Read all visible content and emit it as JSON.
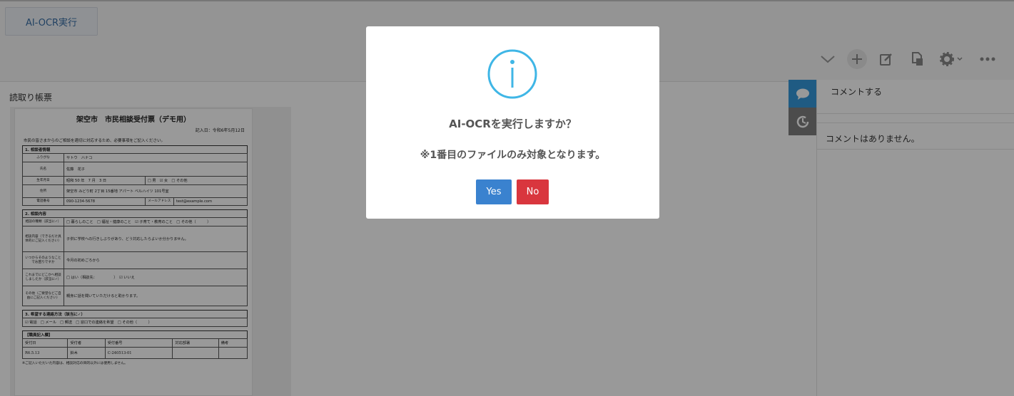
{
  "header": {
    "action_button_label": "AI-OCR実行",
    "toolbar_icons": [
      "chevron-down-icon",
      "plus-icon",
      "edit-icon",
      "copy-document-icon",
      "gear-icon",
      "more-icon"
    ]
  },
  "document": {
    "label": "読取り帳票",
    "form": {
      "title": "架空市　市民相談受付票（デモ用）",
      "date": "記入日：令和6年5月12日",
      "intro": "市民の皆さまからのご相談を適切に対応するため、必要事項をご記入ください。",
      "section1_title": "1. 相談者情報",
      "furigana_label": "ふりがな",
      "furigana_value": "サトウ　ハナコ",
      "name_label": "氏名",
      "name_value": "佐藤　花子",
      "birth_label": "生年月日",
      "birth_value": "昭和 50 年　7 月　3 日",
      "gender_options": "□ 男　☑ 女　□ その他",
      "address_label": "住所",
      "address_value": "架空市 みどり町 2丁目 15番地 アパート ベルハイツ 101号室",
      "phone_label": "電話番号",
      "phone_value": "090-1234-5678",
      "email_label": "メールアドレス",
      "email_value": "test@example.com",
      "section2_title": "2. 相談内容",
      "category_label": "相談の種類（該当に✓）",
      "category_options": "□ 暮らしのこと　□ 福祉・健康のこと　☑ 子育て・教育のこと　□ その他（　　　）",
      "detail_label": "相談内容（できるだけ具体的にご記入ください）",
      "detail_value": "子供に学校への行きしぶりがあり、どう対応したらよいか分かりません。",
      "since_label": "いつからそのようなことでお困りですか",
      "since_value": "今月の初めごろから",
      "prior_label": "これまでにどこかへ相談しましたか（該当に✓）",
      "prior_options": "□ はい（相談先：　　　　　）　☑ いいえ",
      "other_label": "その他（ご要望などご自由にご記入ください）",
      "other_value": "親身に話を聞いていただけると助かります。",
      "section3_title": "3. 希望する連絡方法（該当に✓）",
      "contact_options": "☑ 電話　□ メール　□ 郵送　□ 窓口での連絡を希望　□ その他（　　　）",
      "staff_title": "【職員記入欄】",
      "staff_headers": [
        "受付日",
        "受付者",
        "受付番号",
        "対応部署",
        "備考"
      ],
      "staff_values": [
        "R6.5.13",
        "鈴木",
        "C-240513-01",
        "",
        ""
      ],
      "footnote": "※ご記入いただいた内容は、相談対応の目的以外には使用しません。"
    }
  },
  "side_tabs": [
    {
      "icon": "comment-icon"
    },
    {
      "icon": "history-icon"
    }
  ],
  "comments": {
    "input_placeholder": "コメントする",
    "empty_text": "コメントはありません。"
  },
  "dialog": {
    "icon": "info-icon",
    "message": "AI-OCRを実行しますか？",
    "note": "※1番目のファイルのみ対象となります。",
    "yes_label": "Yes",
    "no_label": "No",
    "yes_color": "#3a82cf",
    "no_color": "#d9363e"
  }
}
